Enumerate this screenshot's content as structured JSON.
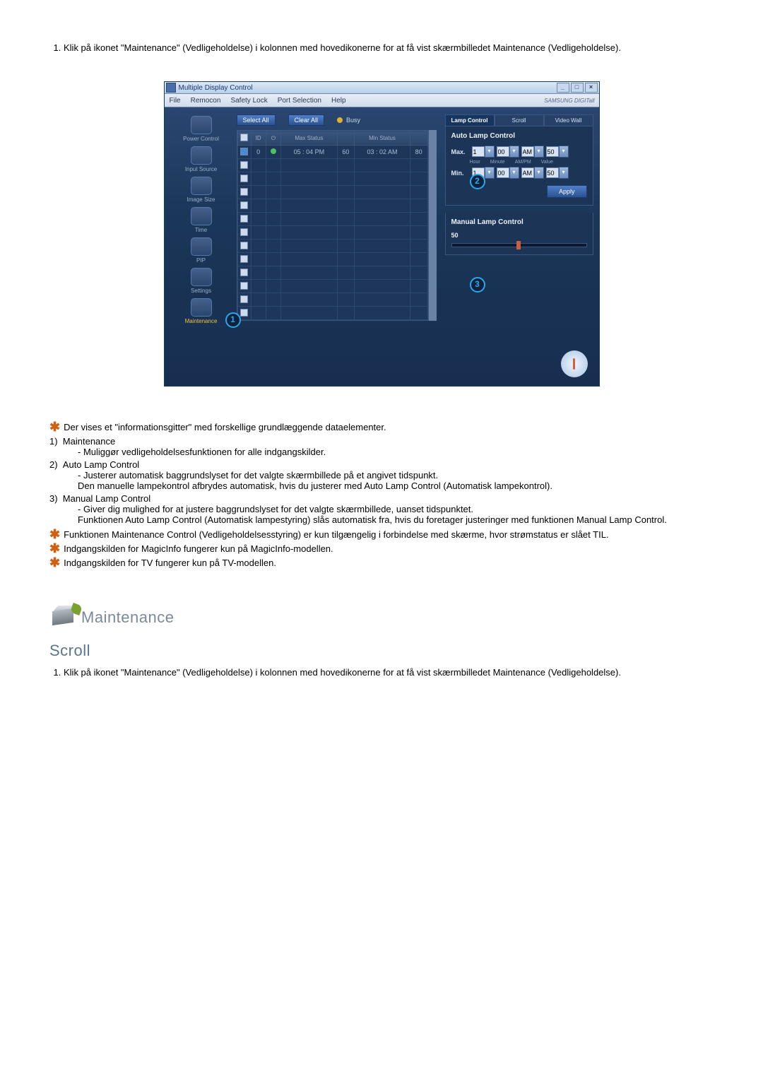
{
  "doc": {
    "intro_num": "1.",
    "intro_text": "Klik på ikonet \"Maintenance\" (Vedligeholdelse) i kolonnen med hovedikonerne for at få vist skærmbilledet Maintenance (Vedligeholdelse).",
    "star1": "Der vises et \"informationsgitter\" med forskellige grundlæggende dataelementer.",
    "list": [
      {
        "n": "1)",
        "title": "Maintenance",
        "body": "- Muliggør vedligeholdelsesfunktionen for alle indgangskilder."
      },
      {
        "n": "2)",
        "title": "Auto Lamp Control",
        "body": "- Justerer automatisk baggrundslyset for det valgte skærmbillede på et angivet tidspunkt.\nDen manuelle lampekontrol afbrydes automatisk, hvis du justerer med Auto Lamp Control (Automatisk lampekontrol)."
      },
      {
        "n": "3)",
        "title": "Manual Lamp Control",
        "body": "- Giver dig mulighed for at justere baggrundslyset for det valgte skærmbillede, uanset tidspunktet.\nFunktionen Auto Lamp Control (Automatisk lampestyring) slås automatisk fra, hvis du foretager justeringer med funktionen Manual Lamp Control."
      }
    ],
    "star2": "Funktionen Maintenance Control (Vedligeholdelsesstyring) er kun tilgængelig i forbindelse med skærme, hvor strømstatus er slået TIL.",
    "star3": "Indgangskilden for MagicInfo fungerer kun på MagicInfo-modellen.",
    "star4": "Indgangskilden for TV fungerer kun på TV-modellen.",
    "section_heading": "Maintenance",
    "scroll_heading": "Scroll",
    "intro2_num": "1.",
    "intro2_text": "Klik på ikonet \"Maintenance\" (Vedligeholdelse) i kolonnen med hovedikonerne for at få vist skærmbilledet Maintenance (Vedligeholdelse)."
  },
  "app": {
    "title": "Multiple Display Control",
    "brand": "SAMSUNG DIGITall",
    "menu": [
      "File",
      "Remocon",
      "Safety Lock",
      "Port Selection",
      "Help"
    ],
    "topbtns": {
      "select_all": "Select All",
      "clear_all": "Clear All",
      "busy": "Busy"
    },
    "side": [
      {
        "label": "Power Control"
      },
      {
        "label": "Input Source"
      },
      {
        "label": "Image Size"
      },
      {
        "label": "Time"
      },
      {
        "label": "PIP"
      },
      {
        "label": "Settings"
      },
      {
        "label": "Maintenance"
      }
    ],
    "grid": {
      "headers": {
        "id": "ID",
        "maxstatus": "Max Status",
        "minstatus": "Min Status"
      },
      "row": {
        "id": "0",
        "maxstatus": "05 : 04 PM",
        "maxv": "60",
        "minstatus": "03 : 02 AM",
        "minv": "80"
      }
    },
    "tabs": {
      "lamp": "Lamp Control",
      "scroll": "Scroll",
      "video": "Video Wall"
    },
    "auto": {
      "title": "Auto Lamp Control",
      "max": "Max.",
      "min": "Min.",
      "hour": "Hour",
      "minute": "Minute",
      "ampm": "AM/PM",
      "value": "Value",
      "h": "1",
      "m": "00",
      "ap": "AM",
      "v": "50",
      "apply": "Apply"
    },
    "manual": {
      "title": "Manual Lamp Control",
      "value": "50"
    },
    "badges": {
      "b1": "1",
      "b2": "2",
      "b3": "3"
    }
  }
}
